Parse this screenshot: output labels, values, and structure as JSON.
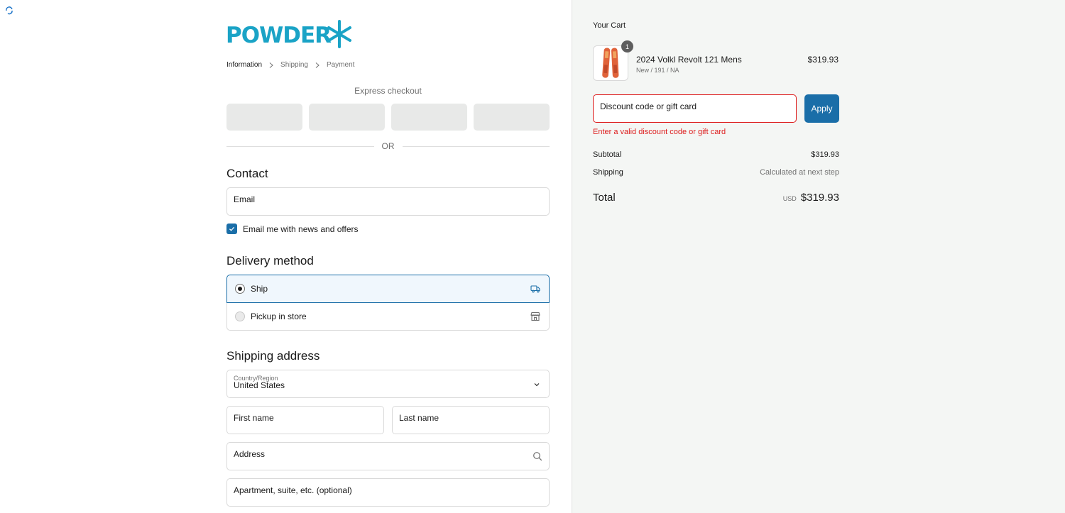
{
  "brand": {
    "logo_text": "POWDER",
    "accent": "#1aa3c6"
  },
  "breadcrumb": [
    "Information",
    "Shipping",
    "Payment"
  ],
  "express": {
    "title": "Express checkout",
    "separator": "OR"
  },
  "contact": {
    "heading": "Contact",
    "email_placeholder": "Email",
    "newsletter_label": "Email me with news and offers",
    "newsletter_checked": true
  },
  "delivery": {
    "heading": "Delivery method",
    "options": [
      {
        "label": "Ship",
        "selected": true,
        "icon": "truck-icon"
      },
      {
        "label": "Pickup in store",
        "selected": false,
        "icon": "store-icon"
      }
    ]
  },
  "shipping_address": {
    "heading": "Shipping address",
    "country_label": "Country/Region",
    "country_value": "United States",
    "first_name": "First name",
    "last_name": "Last name",
    "address": "Address",
    "apartment": "Apartment, suite, etc. (optional)"
  },
  "cart": {
    "title": "Your Cart",
    "item": {
      "name": "2024 Volkl Revolt 121 Mens",
      "variant": "New / 191 / NA",
      "price": "$319.93",
      "quantity": "1"
    },
    "discount_placeholder": "Discount code or gift card",
    "apply_label": "Apply",
    "error": "Enter a valid discount code or gift card",
    "subtotal_label": "Subtotal",
    "subtotal_value": "$319.93",
    "shipping_label": "Shipping",
    "shipping_value": "Calculated at next step",
    "total_label": "Total",
    "currency": "USD",
    "total_value": "$319.93"
  },
  "colors": {
    "primary": "#1a6ea8",
    "error": "#dd1d1d",
    "sidebar_bg": "#f4f6f4"
  }
}
